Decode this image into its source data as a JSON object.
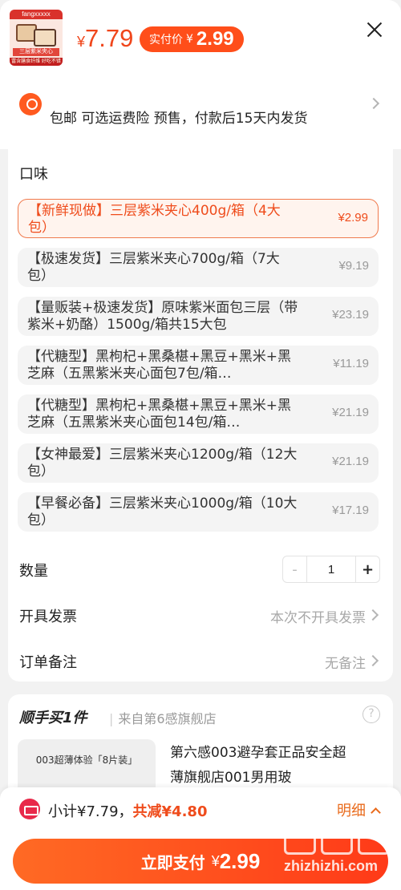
{
  "header": {
    "product_thumb_band": "fangxxxxx",
    "product_thumb_tag": "三层紫米夹心",
    "product_thumb_foot": "富含膳食纤维 好吃不错",
    "currency": "¥",
    "price": "7.79",
    "paid_label": "实付价",
    "paid_currency": "¥",
    "paid_price": "2.99"
  },
  "shipping": {
    "text": "包邮  可选运费险  预售，付款后15天内发货"
  },
  "flavor": {
    "title": "口味",
    "options": [
      {
        "text": "【新鲜现做】三层紫米夹心400g/箱（4大包）",
        "price": "¥2.99",
        "selected": true
      },
      {
        "text": "【极速发货】三层紫米夹心700g/箱（7大包）",
        "price": "¥9.19",
        "selected": false
      },
      {
        "text": "【量贩装+极速发货】原味紫米面包三层（带紫米+奶酪）1500g/箱共15大包",
        "price": "¥23.19",
        "selected": false
      },
      {
        "text": "【代糖型】黑枸杞+黑桑椹+黑豆+黑米+黑芝麻（五黑紫米夹心面包7包/箱…",
        "price": "¥11.19",
        "selected": false
      },
      {
        "text": "【代糖型】黑枸杞+黑桑椹+黑豆+黑米+黑芝麻（五黑紫米夹心面包14包/箱…",
        "price": "¥21.19",
        "selected": false
      },
      {
        "text": "【女神最爱】三层紫米夹心1200g/箱（12大包）",
        "price": "¥21.19",
        "selected": false
      },
      {
        "text": "【早餐必备】三层紫米夹心1000g/箱（10大包）",
        "price": "¥17.19",
        "selected": false
      }
    ]
  },
  "quantity": {
    "label": "数量",
    "minus": "-",
    "value": "1",
    "plus": "+"
  },
  "invoice": {
    "label": "开具发票",
    "value": "本次不开具发票"
  },
  "remark": {
    "label": "订单备注",
    "value": "无备注"
  },
  "addon": {
    "title": "顺手买1件",
    "source": "来自第6感旗舰店",
    "help": "?",
    "image_caption": "003超薄体验「8片装」",
    "product_name": "第六感003避孕套正品安全超薄旗舰店001男用玻"
  },
  "footer": {
    "subtotal": "小计¥7.79，",
    "discount": "共减¥4.80",
    "detail": "明细",
    "pay_label": "立即支付",
    "pay_currency": "¥",
    "pay_price": "2.99"
  },
  "watermark": {
    "site": "zhizhizhi.com"
  },
  "colors": {
    "accent": "#ff4e1a",
    "price_red": "#ef4c1c",
    "selected_border": "#f07a4d",
    "page_bg": "#f2f2f2"
  }
}
